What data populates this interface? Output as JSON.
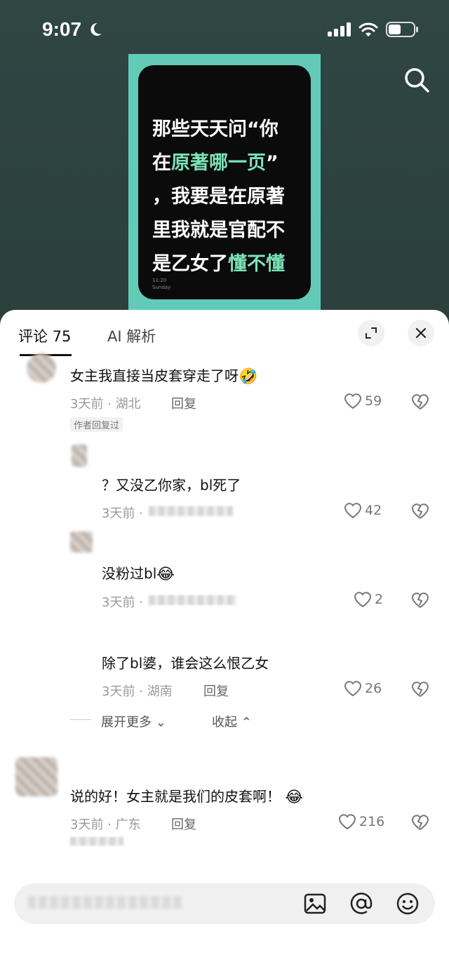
{
  "status_bar": {
    "time": "9:07"
  },
  "video": {
    "text_line1": "那些天天问“你",
    "text_line2_prefix": "在",
    "text_line2_highlight": "原著哪一页",
    "text_line2_suffix": "”",
    "text_line3": "，我要是在原著",
    "text_line4": "里我就是官配不",
    "text_line5_prefix": "是乙女了",
    "text_line5_highlight": "懂不懂",
    "phone_time": "11:20",
    "phone_day": "Sunday",
    "highlight_color": "#7be3b8",
    "card_color": "#62cbb8"
  },
  "sheet": {
    "tab_comments": "评论 75",
    "tab_ai": "AI 解析"
  },
  "comments": [
    {
      "text": "女主我直接当皮套穿走了呀",
      "emoji": "🤣",
      "meta": "3天前 · 湖北",
      "reply": "回复",
      "likes": "59",
      "badge": "作者回复过"
    },
    {
      "text": "？又没乙你家，bl死了",
      "meta": "3天前 ·",
      "likes": "42"
    },
    {
      "text": "没粉过bl",
      "emoji": "😂",
      "meta": "3天前 ·",
      "likes": "2"
    },
    {
      "text": "除了bl婆，谁会这么恨乙女",
      "meta": "3天前 · 湖南",
      "reply": "回复",
      "likes": "26"
    },
    {
      "text": "说的好！女主就是我们的皮套啊！",
      "emoji": "😂",
      "meta": "3天前 · 广东",
      "reply": "回复",
      "likes": "216"
    }
  ],
  "expand": {
    "more": "展开更多",
    "collapse": "收起"
  }
}
